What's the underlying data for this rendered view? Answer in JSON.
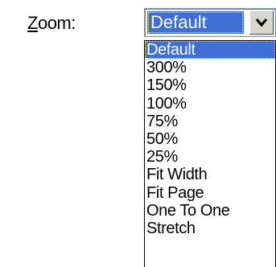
{
  "zoom": {
    "label_mnemonic": "Z",
    "label_rest": "oom:",
    "selected_value": "Default",
    "button_icon": "chevron-down-icon",
    "options": [
      "Default",
      "300%",
      "150%",
      "100%",
      "75%",
      "50%",
      "25%",
      "Fit Width",
      "Fit Page",
      "One To One",
      "Stretch"
    ],
    "highlighted_option": "Default"
  },
  "colors": {
    "selection": "#3f6fd6",
    "selection_text": "#ffffff"
  }
}
